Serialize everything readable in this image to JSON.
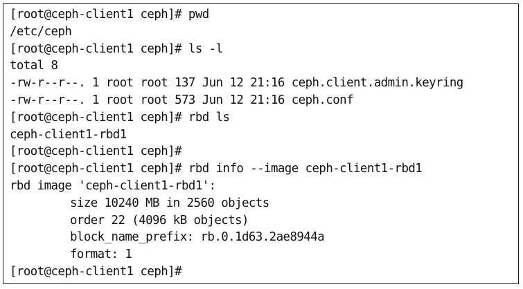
{
  "terminal": {
    "lines": [
      {
        "text": "[root@ceph-client1 ceph]# pwd",
        "indent": false
      },
      {
        "text": "/etc/ceph",
        "indent": false
      },
      {
        "text": "[root@ceph-client1 ceph]# ls -l",
        "indent": false
      },
      {
        "text": "total 8",
        "indent": false
      },
      {
        "text": "-rw-r--r--. 1 root root 137 Jun 12 21:16 ceph.client.admin.keyring",
        "indent": false
      },
      {
        "text": "-rw-r--r--. 1 root root 573 Jun 12 21:16 ceph.conf",
        "indent": false
      },
      {
        "text": "[root@ceph-client1 ceph]# rbd ls",
        "indent": false
      },
      {
        "text": "ceph-client1-rbd1",
        "indent": false
      },
      {
        "text": "[root@ceph-client1 ceph]#",
        "indent": false
      },
      {
        "text": "[root@ceph-client1 ceph]# rbd info --image ceph-client1-rbd1",
        "indent": false
      },
      {
        "text": "rbd image 'ceph-client1-rbd1':",
        "indent": false
      },
      {
        "text": "size 10240 MB in 2560 objects",
        "indent": true
      },
      {
        "text": "order 22 (4096 kB objects)",
        "indent": true
      },
      {
        "text": "block_name_prefix: rb.0.1d63.2ae8944a",
        "indent": true
      },
      {
        "text": "format: 1",
        "indent": true
      },
      {
        "text": "[root@ceph-client1 ceph]#",
        "indent": false
      }
    ]
  }
}
